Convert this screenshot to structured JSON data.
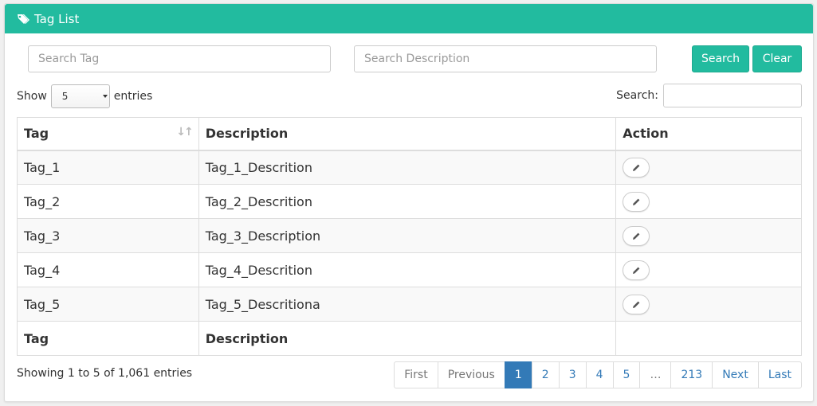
{
  "header": {
    "title": "Tag List",
    "icon": "tags-icon"
  },
  "filters": {
    "tag_placeholder": "Search Tag",
    "description_placeholder": "Search Description",
    "search_label": "Search",
    "clear_label": "Clear"
  },
  "length": {
    "show_label": "Show",
    "selected": "5",
    "entries_label": "entries"
  },
  "search": {
    "label": "Search:"
  },
  "table": {
    "columns": [
      "Tag",
      "Description",
      "Action"
    ],
    "rows": [
      {
        "tag": "Tag_1",
        "description": "Tag_1_Descrition"
      },
      {
        "tag": "Tag_2",
        "description": "Tag_2_Descrition"
      },
      {
        "tag": "Tag_3",
        "description": "Tag_3_Description"
      },
      {
        "tag": "Tag_4",
        "description": "Tag_4_Descrition"
      },
      {
        "tag": "Tag_5",
        "description": "Tag_5_Descritiona"
      }
    ],
    "footer": [
      "Tag",
      "Description",
      ""
    ]
  },
  "info": "Showing 1 to 5 of 1,061 entries",
  "pagination": {
    "first": "First",
    "previous": "Previous",
    "pages": [
      "1",
      "2",
      "3",
      "4",
      "5"
    ],
    "ellipsis": "…",
    "last_page": "213",
    "next": "Next",
    "last": "Last",
    "current": "1"
  },
  "colors": {
    "accent": "#22bb9f",
    "link": "#337ab7"
  }
}
